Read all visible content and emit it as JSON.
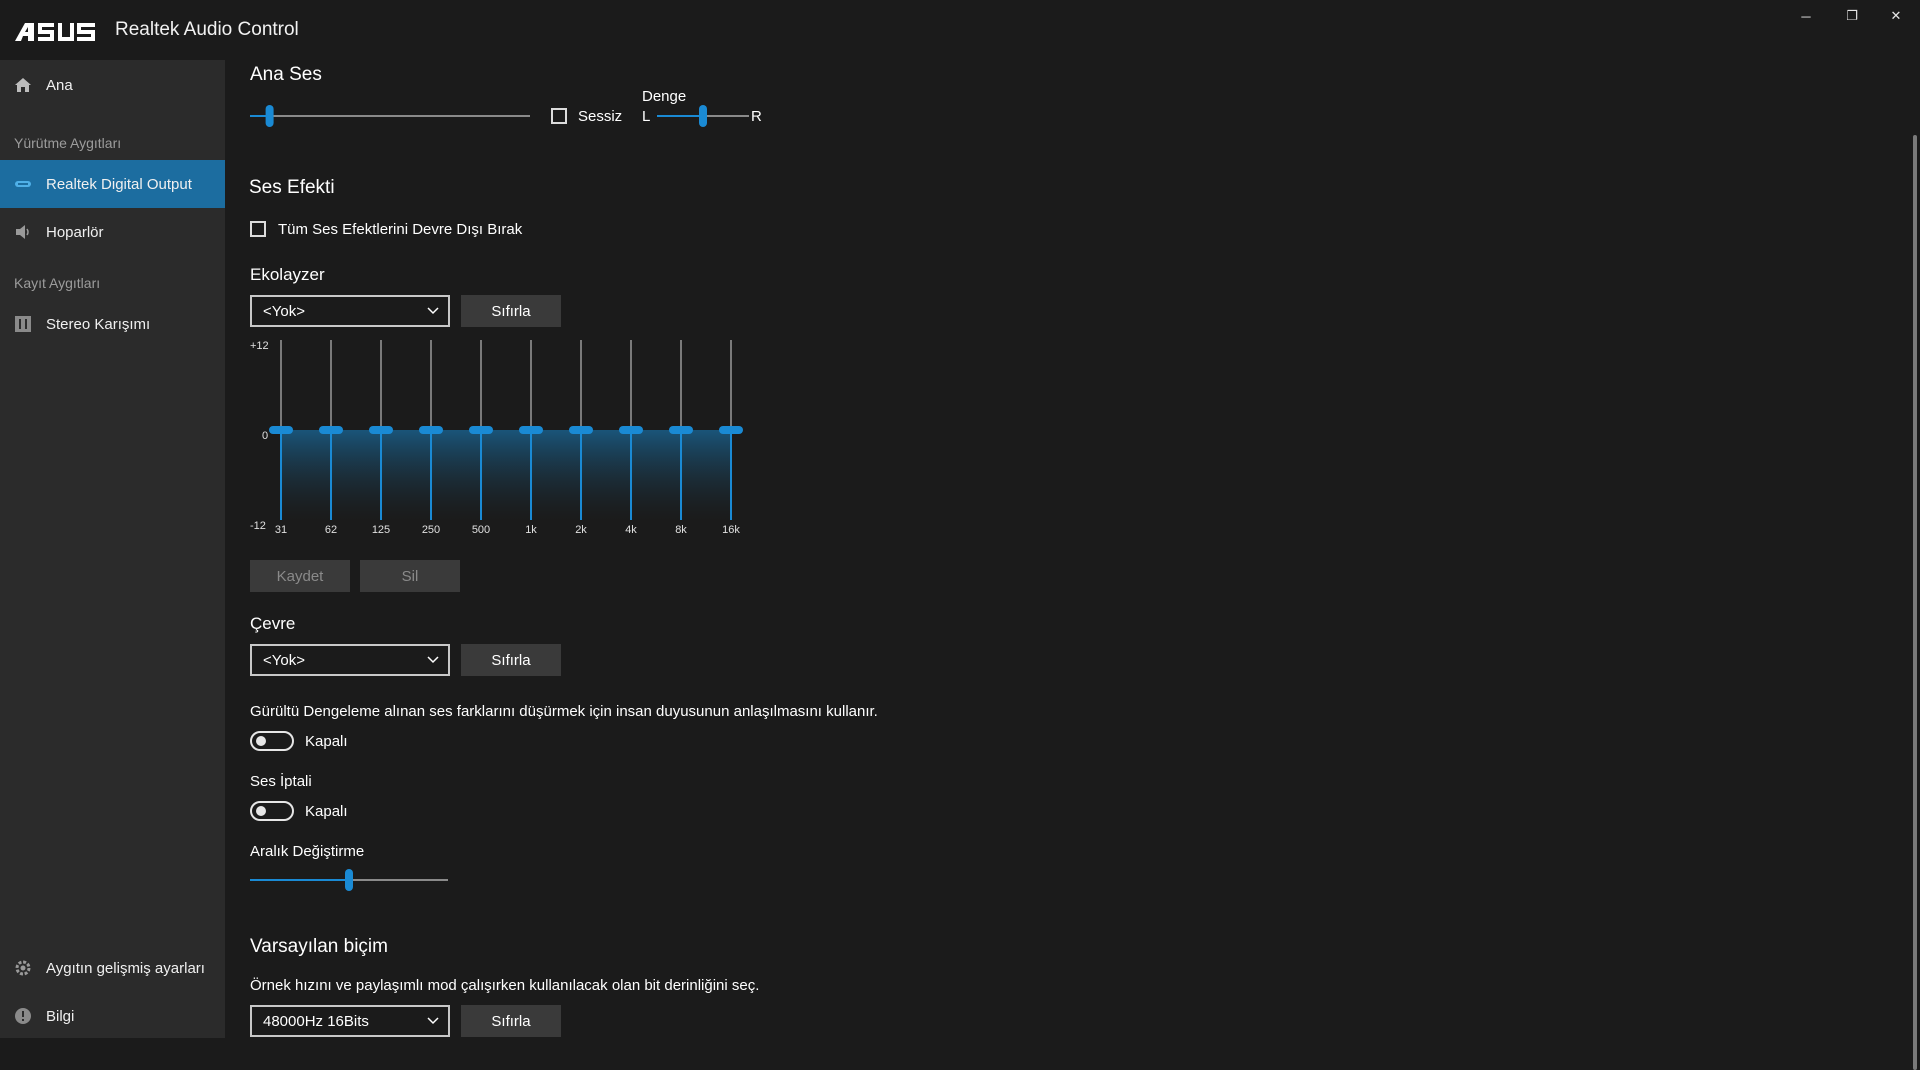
{
  "app": {
    "title": "Realtek Audio Control",
    "logo_text": "ASUS"
  },
  "window_controls": {
    "minimize": "─",
    "restore": "❐",
    "close": "✕"
  },
  "sidebar": {
    "home": {
      "label": "Ana",
      "icon": "home-icon"
    },
    "playback_header": "Yürütme Aygıtları",
    "playback_items": [
      {
        "label": "Realtek Digital Output",
        "icon": "digital-output-icon",
        "active": true
      },
      {
        "label": "Hoparlör",
        "icon": "speaker-icon",
        "active": false
      }
    ],
    "recording_header": "Kayıt Aygıtları",
    "recording_items": [
      {
        "label": "Stereo Karışımı",
        "icon": "stereo-mix-icon"
      }
    ],
    "advanced": {
      "label": "Aygıtın gelişmiş ayarları",
      "icon": "gear-icon"
    },
    "info": {
      "label": "Bilgi",
      "icon": "info-icon"
    }
  },
  "main_volume": {
    "title": "Ana Ses",
    "level": 0.07,
    "mute_label": "Sessiz",
    "mute_checked": false,
    "balance_label": "Denge",
    "balance_left": "L",
    "balance_right": "R",
    "balance_level": 0.5
  },
  "effects": {
    "title": "Ses Efekti",
    "disable_all_label": "Tüm Ses Efektlerini Devre Dışı Bırak",
    "disable_all_checked": false
  },
  "equalizer": {
    "title": "Ekolayzer",
    "preset": "<Yok>",
    "reset_label": "Sıfırla",
    "save_label": "Kaydet",
    "delete_label": "Sil",
    "y_labels": [
      "+12",
      "0",
      "-12"
    ],
    "bands": [
      "31",
      "62",
      "125",
      "250",
      "500",
      "1k",
      "2k",
      "4k",
      "8k",
      "16k"
    ],
    "gains": [
      0,
      0,
      0,
      0,
      0,
      0,
      0,
      0,
      0,
      0
    ],
    "accent": "#1a8ad4"
  },
  "environment": {
    "title": "Çevre",
    "preset": "<Yok>",
    "reset_label": "Sıfırla"
  },
  "loudness": {
    "description": "Gürültü Dengeleme alınan ses farklarını düşürmek için insan duyusunun anlaşılmasını kullanır.",
    "state": "Kapalı",
    "on": false
  },
  "voice_cancel": {
    "title": "Ses İptali",
    "state": "Kapalı",
    "on": false
  },
  "pitch": {
    "title": "Aralık Değiştirme",
    "level": 0.5
  },
  "default_format": {
    "title": "Varsayılan biçim",
    "description": "Örnek hızını ve paylaşımlı mod çalışırken kullanılacak olan bit derinliğini seç.",
    "value": "48000Hz 16Bits",
    "reset_label": "Sıfırla"
  }
}
